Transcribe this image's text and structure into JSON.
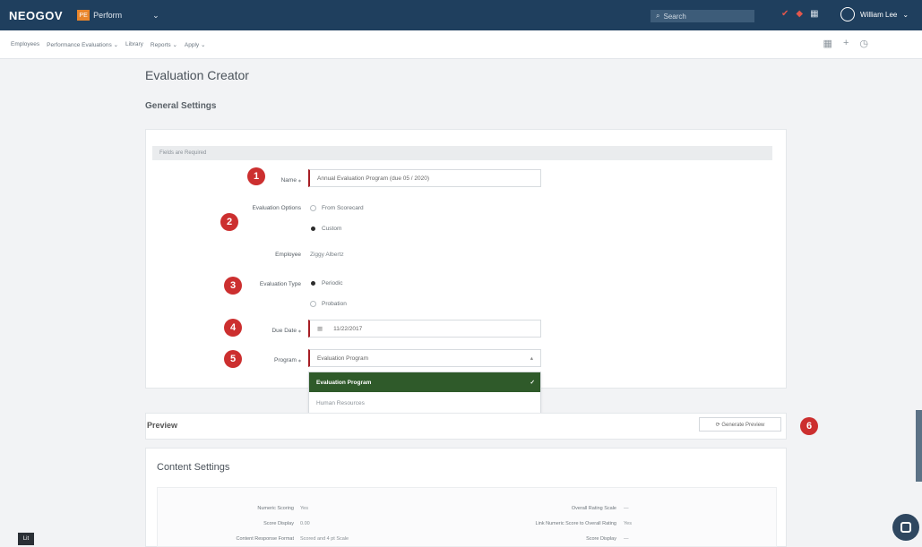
{
  "topbar": {
    "logo": "NEOGOV",
    "product_badge": "PE",
    "product_name": "Perform",
    "search_placeholder": "Search",
    "user_name": "William Lee"
  },
  "nav": {
    "items": [
      "Employees",
      "Performance Evaluations ⌄",
      "Library",
      "Reports ⌄",
      "Apply ⌄"
    ]
  },
  "page": {
    "title": "Evaluation Creator",
    "general_settings": "General Settings",
    "form_header": "Fields are Required"
  },
  "form": {
    "name_label": "Name ⁎",
    "name_value": "Annual Evaluation Program (due 05 / 2020)",
    "eval_options_label": "Evaluation Options",
    "eval_option_1": "From Scorecard",
    "eval_option_2": "Custom",
    "employee_label": "Employee",
    "employee_value": "Ziggy Albertz",
    "eval_type_label": "Evaluation Type",
    "eval_type_1": "Periodic",
    "eval_type_2": "Probation",
    "due_date_label": "Due Date ⁎",
    "due_date_value": "11/22/2017",
    "program_label": "Program ⁎",
    "program_value": "Evaluation Program",
    "dropdown_options": [
      "Evaluation Program",
      "Human Resources"
    ]
  },
  "markers": [
    "1",
    "2",
    "3",
    "4",
    "5",
    "6"
  ],
  "preview": {
    "title": "Preview",
    "generate_label": "⟳ Generate Preview"
  },
  "content_settings": {
    "title": "Content Settings",
    "left": [
      {
        "label": "Numeric Scoring",
        "value": "Yes"
      },
      {
        "label": "Score Display",
        "value": "0.00"
      },
      {
        "label": "Content Response Format",
        "value": "Scored and 4 pt Scale"
      }
    ],
    "right": [
      {
        "label": "Overall Rating Scale",
        "value": "—"
      },
      {
        "label": "Link Numeric Score to Overall Rating",
        "value": "Yes"
      },
      {
        "label": "Score Display",
        "value": "—"
      }
    ]
  },
  "corner_label": "Lit",
  "colors": {
    "topbar": "#1f3f5e",
    "marker": "#cc2f2f",
    "required": "#a61d24",
    "selected_option": "#2f5a2a"
  }
}
